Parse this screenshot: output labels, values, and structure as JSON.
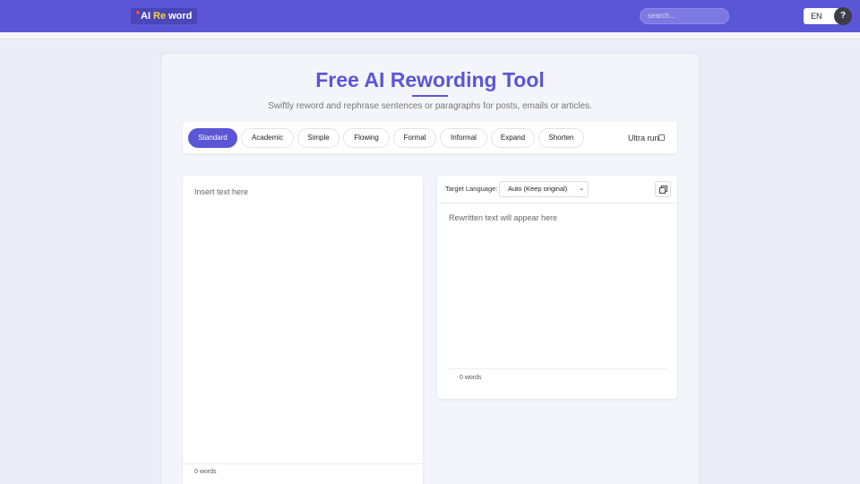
{
  "header": {
    "logo": {
      "ai": "AI",
      "re": "Re",
      "word": "word"
    },
    "search_placeholder": "search...",
    "language": "EN",
    "help": "?"
  },
  "main": {
    "title": "Free AI Rewording Tool",
    "subtitle": "Swiftly reword and rephrase sentences or paragraphs for posts, emails or articles.",
    "modes": [
      "Standard",
      "Academic",
      "Simple",
      "Flowing",
      "Formal",
      "Informal",
      "Expand",
      "Shorten"
    ],
    "active_mode": "Standard",
    "ultra_run_label": "Ultra run",
    "ultra_run_checked": false
  },
  "input": {
    "placeholder": "Insert text here",
    "word_count": "0 words"
  },
  "output": {
    "target_language_label": "Target Language:",
    "target_language_value": "Auto (Keep original)",
    "placeholder": "Rewritten text will appear here",
    "word_count": "0 words"
  },
  "colors": {
    "brand": "#5b56d6",
    "page_bg": "#ececf7",
    "logo_accent": "#ffd23f"
  }
}
